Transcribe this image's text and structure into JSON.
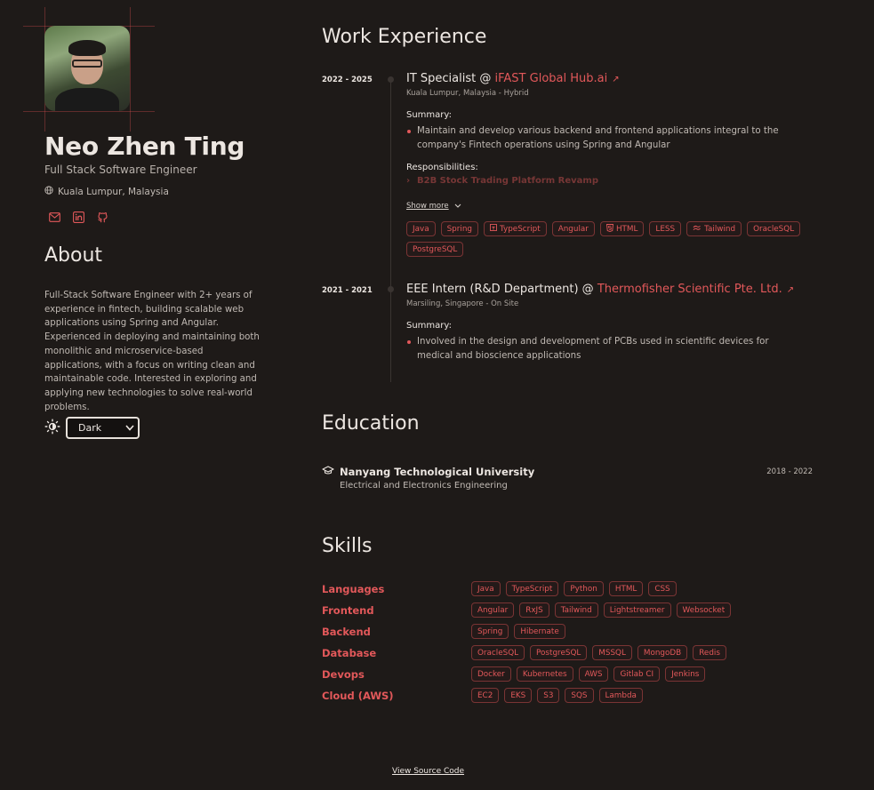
{
  "profile": {
    "name": "Neo Zhen Ting",
    "title": "Full Stack Software Engineer",
    "location": "Kuala Lumpur, Malaysia"
  },
  "socials": [
    {
      "icon": "mail-icon"
    },
    {
      "icon": "linkedin-icon"
    },
    {
      "icon": "github-icon"
    }
  ],
  "about": {
    "heading": "About",
    "text": "Full-Stack Software Engineer with 2+ years of experience in fintech, building scalable web applications using Spring and Angular. Experienced in deploying and maintaining both monolithic and microservice-based applications, with a focus on writing clean and maintainable code. Interested in exploring and applying new technologies to solve real-world problems."
  },
  "theme": {
    "selected": "Dark"
  },
  "work": {
    "heading": "Work Experience",
    "jobs": [
      {
        "years": "2022 - 2025",
        "role": "IT Specialist @",
        "company": "iFAST Global Hub.ai",
        "location": "Kuala Lumpur, Malaysia - Hybrid",
        "summary_label": "Summary:",
        "summary": [
          "Maintain and develop various backend and frontend applications integral to the company's Fintech operations using Spring and Angular"
        ],
        "responsibilities_label": "Responsibilities:",
        "responsibility_preview": "B2B Stock Trading Platform Revamp",
        "show_more": "Show more",
        "tags": [
          "Java",
          "Spring",
          "TypeScript",
          "Angular",
          "HTML",
          "LESS",
          "Tailwind",
          "OracleSQL",
          "PostgreSQL"
        ]
      },
      {
        "years": "2021 - 2021",
        "role": "EEE Intern (R&D Department) @",
        "company": "Thermofisher Scientific Pte. Ltd.",
        "location": "Marsiling, Singapore - On Site",
        "summary_label": "Summary:",
        "summary": [
          "Involved in the design and development of PCBs used in scientific devices for medical and bioscience applications"
        ]
      }
    ]
  },
  "education": {
    "heading": "Education",
    "school": "Nanyang Technological University",
    "degree": "Electrical and Electronics Engineering",
    "years": "2018 - 2022"
  },
  "skills": {
    "heading": "Skills",
    "categories": [
      {
        "name": "Languages",
        "items": [
          "Java",
          "TypeScript",
          "Python",
          "HTML",
          "CSS"
        ]
      },
      {
        "name": "Frontend",
        "items": [
          "Angular",
          "RxJS",
          "Tailwind",
          "Lightstreamer",
          "Websocket"
        ]
      },
      {
        "name": "Backend",
        "items": [
          "Spring",
          "Hibernate"
        ]
      },
      {
        "name": "Database",
        "items": [
          "OracleSQL",
          "PostgreSQL",
          "MSSQL",
          "MongoDB",
          "Redis"
        ]
      },
      {
        "name": "Devops",
        "items": [
          "Docker",
          "Kubernetes",
          "AWS",
          "Gitlab CI",
          "Jenkins"
        ]
      },
      {
        "name": "Cloud (AWS)",
        "items": [
          "EC2",
          "EKS",
          "S3",
          "SQS",
          "Lambda"
        ]
      }
    ]
  },
  "footer": {
    "link": "View Source Code"
  },
  "colors": {
    "background": "#1e1a18",
    "accent": "#e2585a",
    "text": "#ece6e1"
  }
}
